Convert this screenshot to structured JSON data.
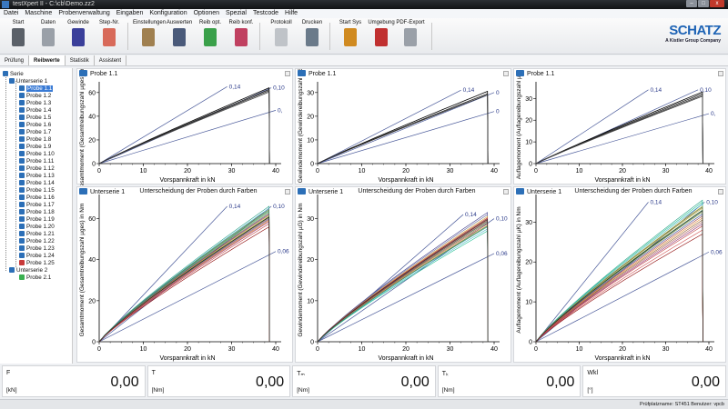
{
  "window": {
    "title": "testXpert II - C:\\cb\\Demo.zz2"
  },
  "menu": [
    "Datei",
    "Maschine",
    "Probenverwaltung",
    "Eingaben",
    "Konfiguration",
    "Optionen",
    "Spezial",
    "Testcode",
    "Hilfe"
  ],
  "toolbar": [
    {
      "label": "Start",
      "icon": "start-icon",
      "color": "#5a6068"
    },
    {
      "label": "Daten",
      "icon": "data-sheet-icon",
      "color": "#9aa0a8"
    },
    {
      "label": "Gewinde",
      "icon": "bolt-icon",
      "color": "#3a3f9a"
    },
    {
      "label": "Step-Nr.",
      "icon": "step-chart-icon",
      "color": "#d86a5a"
    },
    {
      "label": "Einstellungen",
      "icon": "settings-pencil-icon",
      "color": "#a08050"
    },
    {
      "label": "Auswerten",
      "icon": "calculator-icon",
      "color": "#4a5a7a"
    },
    {
      "label": "Reib opt.",
      "icon": "friction-ok-icon",
      "color": "#3aa04a"
    },
    {
      "label": "Reib konf.",
      "icon": "friction-config-icon",
      "color": "#c04060"
    },
    {
      "label": "Protokoll",
      "icon": "protocol-icon",
      "color": "#bfc3c8"
    },
    {
      "label": "Drucken",
      "icon": "printer-icon",
      "color": "#6a7a8a"
    },
    {
      "label": "Start Sys",
      "icon": "start-system-icon",
      "color": "#d08a20"
    },
    {
      "label": "Umgebung",
      "icon": "thermometer-icon",
      "color": "#c03030"
    },
    {
      "label": "PDF-Export",
      "icon": "pdf-export-icon",
      "color": "#9aa0a8"
    }
  ],
  "logo": {
    "name": "SCHATZ",
    "tagline": "A Kistler Group Company"
  },
  "tabs": [
    {
      "label": "Prüfung",
      "active": false
    },
    {
      "label": "Reibwerte",
      "active": true
    },
    {
      "label": "Statistik",
      "active": false
    },
    {
      "label": "Assistent",
      "active": false
    }
  ],
  "tree": {
    "root": "Serie",
    "groups": [
      {
        "label": "Unterserie 1",
        "items": [
          "Probe 1.1",
          "Probe 1.2",
          "Probe 1.3",
          "Probe 1.4",
          "Probe 1.5",
          "Probe 1.6",
          "Probe 1.7",
          "Probe 1.8",
          "Probe 1.9",
          "Probe 1.10",
          "Probe 1.11",
          "Probe 1.12",
          "Probe 1.13",
          "Probe 1.14",
          "Probe 1.15",
          "Probe 1.16",
          "Probe 1.17",
          "Probe 1.18",
          "Probe 1.19",
          "Probe 1.20",
          "Probe 1.21",
          "Probe 1.22",
          "Probe 1.23",
          "Probe 1.24",
          "Probe 1.25"
        ],
        "selected": "Probe 1.1",
        "flagged": "Probe 1.25"
      },
      {
        "label": "Unterserie 2",
        "items": [
          "Probe 2.1"
        ]
      }
    ]
  },
  "chart_data": [
    {
      "type": "line",
      "title": "Probe 1.1",
      "subtitle": "",
      "xlabel": "Vorspannkraft in kN",
      "ylabel": "Gesamtmoment (Gesamtreibungszahl µges) in Nm",
      "xlim": [
        0,
        40
      ],
      "ylim": [
        0,
        66
      ],
      "xticks": [
        0,
        10,
        20,
        30,
        40
      ],
      "yticks": [
        0,
        20,
        40,
        60
      ],
      "reference_lines": [
        {
          "label": "0,14",
          "x": 29,
          "y": 65
        },
        {
          "label": "0,10",
          "x": 39,
          "y": 64
        },
        {
          "label": "0,",
          "x": 40,
          "y": 45
        }
      ],
      "series": [
        {
          "color": "#000000",
          "x_end": 38.5,
          "y_end": 64
        },
        {
          "color": "#222222",
          "x_end": 38.5,
          "y_end": 62.5
        },
        {
          "color": "#333333",
          "x_end": 38.5,
          "y_end": 61.5
        },
        {
          "color": "#444444",
          "x_end": 38.5,
          "y_end": 60.5
        }
      ]
    },
    {
      "type": "line",
      "title": "Probe 1.1",
      "subtitle": "",
      "xlabel": "Vorspannkraft in kN",
      "ylabel": "Gewindemoment (Gewindereibungszahl µG)",
      "xlim": [
        0,
        40
      ],
      "ylim": [
        0,
        33
      ],
      "xticks": [
        0,
        10,
        20,
        30,
        40
      ],
      "yticks": [
        0,
        10,
        20,
        30
      ],
      "reference_lines": [
        {
          "label": "0,14",
          "x": 32.5,
          "y": 31
        },
        {
          "label": "0",
          "x": 40,
          "y": 30
        },
        {
          "label": "0",
          "x": 40,
          "y": 22
        }
      ],
      "series": [
        {
          "color": "#000000",
          "x_end": 38.5,
          "y_end": 30.5
        },
        {
          "color": "#222222",
          "x_end": 38.5,
          "y_end": 29.5
        },
        {
          "color": "#333333",
          "x_end": 38.5,
          "y_end": 29
        }
      ]
    },
    {
      "type": "line",
      "title": "Probe 1.1",
      "subtitle": "",
      "xlabel": "Vorspannkraft in kN",
      "ylabel": "Auflagemoment (Auflagereibungszahl µK)",
      "xlim": [
        0,
        40
      ],
      "ylim": [
        0,
        36
      ],
      "xticks": [
        0,
        10,
        20,
        30,
        40
      ],
      "yticks": [
        0,
        10,
        20,
        30
      ],
      "reference_lines": [
        {
          "label": "0,14",
          "x": 26,
          "y": 34
        },
        {
          "label": "0,10",
          "x": 37.5,
          "y": 34
        },
        {
          "label": "0,",
          "x": 40,
          "y": 23
        }
      ],
      "series": [
        {
          "color": "#000000",
          "x_end": 38.5,
          "y_end": 33
        },
        {
          "color": "#222222",
          "x_end": 38.5,
          "y_end": 32.2
        },
        {
          "color": "#333333",
          "x_end": 38.5,
          "y_end": 31.5
        },
        {
          "color": "#444444",
          "x_end": 38.5,
          "y_end": 31
        }
      ]
    },
    {
      "type": "line",
      "title": "Unterserie 1",
      "subtitle": "Unterscheidung der Proben durch Farben",
      "xlabel": "Vorspannkraft in kN",
      "ylabel": "Gesamtmoment (Gesamtreibungszahl µges) in Nm",
      "xlim": [
        0,
        40
      ],
      "ylim": [
        0,
        70
      ],
      "xticks": [
        0,
        10,
        20,
        30,
        40
      ],
      "yticks": [
        0,
        20,
        40,
        60
      ],
      "reference_lines": [
        {
          "label": "0,14",
          "x": 29,
          "y": 66
        },
        {
          "label": "0,10",
          "x": 39,
          "y": 66
        },
        {
          "label": "0,06",
          "x": 40,
          "y": 44
        }
      ],
      "series": [
        {
          "color": "#2aa38a",
          "x_end": 38.5,
          "y_end": 66
        },
        {
          "color": "#47b4c9",
          "x_end": 38.5,
          "y_end": 65
        },
        {
          "color": "#6c9a3a",
          "x_end": 38.5,
          "y_end": 64
        },
        {
          "color": "#c9a22a",
          "x_end": 38.5,
          "y_end": 63
        },
        {
          "color": "#3b4aa0",
          "x_end": 38.5,
          "y_end": 62.5
        },
        {
          "color": "#a04040",
          "x_end": 38.5,
          "y_end": 62
        },
        {
          "color": "#d8c040",
          "x_end": 38.5,
          "y_end": 61.5
        },
        {
          "color": "#308040",
          "x_end": 38.5,
          "y_end": 61
        },
        {
          "color": "#8a5a2a",
          "x_end": 38.5,
          "y_end": 60.5
        },
        {
          "color": "#5a5a9a",
          "x_end": 38.5,
          "y_end": 60
        },
        {
          "color": "#b06060",
          "x_end": 38.5,
          "y_end": 59.5
        },
        {
          "color": "#e08a30",
          "x_end": 38.5,
          "y_end": 59
        },
        {
          "color": "#20a0a0",
          "x_end": 38.5,
          "y_end": 63.5
        },
        {
          "color": "#903070",
          "x_end": 38.5,
          "y_end": 58.5
        },
        {
          "color": "#8b0000",
          "x_end": 38.5,
          "y_end": 56
        },
        {
          "color": "#c04040",
          "x_end": 38.5,
          "y_end": 57.5
        },
        {
          "color": "#507050",
          "x_end": 38.5,
          "y_end": 64.5
        },
        {
          "color": "#222222",
          "x_end": 38.5,
          "y_end": 60.8
        }
      ]
    },
    {
      "type": "line",
      "title": "Unterserie 1",
      "subtitle": "Unterscheidung der Proben durch Farben",
      "xlabel": "Vorspannkraft in kN",
      "ylabel": "Gewindemoment (Gewindereibungszahl µG) in Nm",
      "xlim": [
        0,
        40
      ],
      "ylim": [
        0,
        35
      ],
      "xticks": [
        0,
        10,
        20,
        30,
        40
      ],
      "yticks": [
        0,
        10,
        20,
        30
      ],
      "reference_lines": [
        {
          "label": "0,14",
          "x": 33,
          "y": 31
        },
        {
          "label": "0,10",
          "x": 40,
          "y": 30
        },
        {
          "label": "0,06",
          "x": 40,
          "y": 21.5
        }
      ],
      "series": [
        {
          "color": "#3b3b8a",
          "x_end": 38.5,
          "y_end": 31.5
        },
        {
          "color": "#6a6aa0",
          "x_end": 38.5,
          "y_end": 31
        },
        {
          "color": "#c9a22a",
          "x_end": 38.5,
          "y_end": 30.5
        },
        {
          "color": "#a04040",
          "x_end": 38.5,
          "y_end": 30
        },
        {
          "color": "#e08a30",
          "x_end": 38.5,
          "y_end": 29.7
        },
        {
          "color": "#308040",
          "x_end": 38.5,
          "y_end": 29.3
        },
        {
          "color": "#8a5a2a",
          "x_end": 38.5,
          "y_end": 29
        },
        {
          "color": "#b06060",
          "x_end": 38.5,
          "y_end": 28.7
        },
        {
          "color": "#d8c040",
          "x_end": 38.5,
          "y_end": 28.4
        },
        {
          "color": "#2aa38a",
          "x_end": 38.5,
          "y_end": 28
        },
        {
          "color": "#47b4c9",
          "x_end": 38.5,
          "y_end": 27.5
        },
        {
          "color": "#20c090",
          "x_end": 38.5,
          "y_end": 27
        },
        {
          "color": "#903070",
          "x_end": 38.5,
          "y_end": 29.5
        },
        {
          "color": "#c04040",
          "x_end": 38.5,
          "y_end": 30.2
        },
        {
          "color": "#507050",
          "x_end": 38.5,
          "y_end": 28.2
        },
        {
          "color": "#222222",
          "x_end": 38.5,
          "y_end": 29.8
        }
      ]
    },
    {
      "type": "line",
      "title": "Unterserie 1",
      "subtitle": "Unterscheidung der Proben durch Farben",
      "xlabel": "Vorspannkraft in kN",
      "ylabel": "Auflagemoment (Auflagereibungszahl µK) in Nm",
      "xlim": [
        0,
        40
      ],
      "ylim": [
        0,
        36
      ],
      "xticks": [
        0,
        10,
        20,
        30,
        40
      ],
      "yticks": [
        0,
        10,
        20,
        30
      ],
      "reference_lines": [
        {
          "label": "0,14",
          "x": 26,
          "y": 35
        },
        {
          "label": "0,10",
          "x": 39,
          "y": 35
        },
        {
          "label": "0,06",
          "x": 40,
          "y": 22.5
        }
      ],
      "series": [
        {
          "color": "#2aa38a",
          "x_end": 38.5,
          "y_end": 35.5
        },
        {
          "color": "#20c090",
          "x_end": 38.5,
          "y_end": 35
        },
        {
          "color": "#47b4c9",
          "x_end": 38.5,
          "y_end": 34.5
        },
        {
          "color": "#d8c040",
          "x_end": 38.5,
          "y_end": 34
        },
        {
          "color": "#c9a22a",
          "x_end": 38.5,
          "y_end": 33.5
        },
        {
          "color": "#308040",
          "x_end": 38.5,
          "y_end": 33
        },
        {
          "color": "#6c9a3a",
          "x_end": 38.5,
          "y_end": 32.5
        },
        {
          "color": "#3b4aa0",
          "x_end": 38.5,
          "y_end": 32
        },
        {
          "color": "#a04040",
          "x_end": 38.5,
          "y_end": 31.5
        },
        {
          "color": "#e08a30",
          "x_end": 38.5,
          "y_end": 31
        },
        {
          "color": "#8a5a2a",
          "x_end": 38.5,
          "y_end": 30.5
        },
        {
          "color": "#b06060",
          "x_end": 38.5,
          "y_end": 30
        },
        {
          "color": "#903070",
          "x_end": 38.5,
          "y_end": 29.5
        },
        {
          "color": "#c04040",
          "x_end": 38.5,
          "y_end": 29
        },
        {
          "color": "#8b0000",
          "x_end": 38.5,
          "y_end": 27
        },
        {
          "color": "#d05050",
          "x_end": 38.5,
          "y_end": 28
        },
        {
          "color": "#507050",
          "x_end": 38.5,
          "y_end": 33.8
        },
        {
          "color": "#222222",
          "x_end": 38.5,
          "y_end": 32.8
        }
      ]
    }
  ],
  "readouts": [
    {
      "label": "F",
      "unit": "[kN]",
      "value": "0,00"
    },
    {
      "label": "T",
      "unit": "[Nm]",
      "value": "0,00"
    },
    {
      "label": "Tₘ",
      "unit": "[Nm]",
      "value": "0,00"
    },
    {
      "label": "Tₖ",
      "unit": "[Nm]",
      "value": "0,00"
    },
    {
      "label": "Wkl",
      "unit": "[°]",
      "value": "0,00"
    }
  ],
  "status": {
    "text": "Prüfplatzname: ST451   Benutzer: vpcb"
  }
}
